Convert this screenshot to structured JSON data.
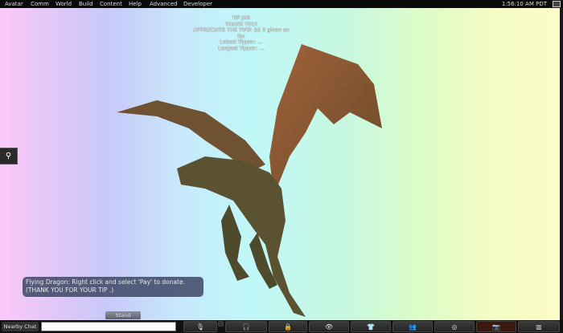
{
  "menubar": {
    "items": [
      "Avatar",
      "Comm",
      "World",
      "Build",
      "Content",
      "Help",
      "Advanced",
      "Developer"
    ],
    "clock": "1:56:10 AM PDT"
  },
  "tipjar": {
    "lines": [
      "TIP JAR",
      "THANK YOU!",
      "APPRECIATE THE TIPS! $$    0 given so far",
      "Latest Tipper: ...",
      "Largest Tipper: ..."
    ]
  },
  "chat_bubble": {
    "line1": "Flying Dragon: Right click and select 'Pay' to donate.",
    "line2": "(THANK YOU FOR YOUR TIP .)"
  },
  "stand_label": "Stand",
  "bottom": {
    "nearby_chat_label": "Nearby Chat",
    "chat_value": "",
    "toolbar_icons": [
      "microphone-icon",
      "headphones-icon",
      "lock-icon",
      "eye-icon",
      "shirt-icon",
      "people-icon",
      "radar-icon",
      "camera-icon",
      "toolbox-icon"
    ]
  },
  "colors": {
    "menubar": "#0a0a0a",
    "camera_active": "#3a1a10"
  }
}
